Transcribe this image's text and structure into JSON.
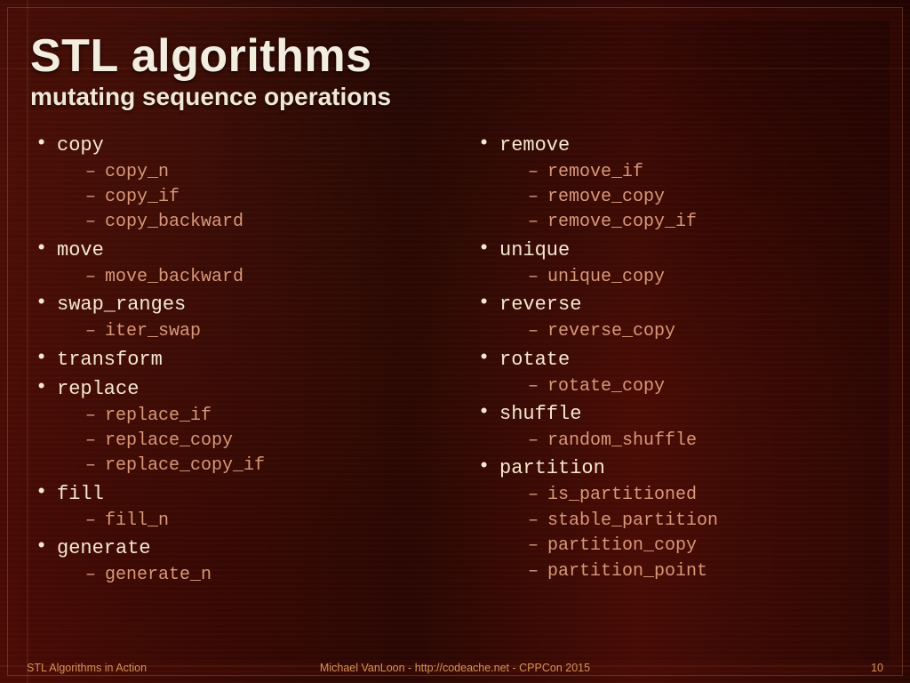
{
  "title": "STL algorithms",
  "subtitle": "mutating sequence operations",
  "columns": [
    [
      {
        "label": "copy",
        "children": [
          "copy_n",
          "copy_if",
          "copy_backward"
        ]
      },
      {
        "label": "move",
        "children": [
          "move_backward"
        ]
      },
      {
        "label": "swap_ranges",
        "children": [
          "iter_swap"
        ]
      },
      {
        "label": "transform",
        "children": []
      },
      {
        "label": "replace",
        "children": [
          "replace_if",
          "replace_copy",
          "replace_copy_if"
        ]
      },
      {
        "label": "fill",
        "children": [
          "fill_n"
        ]
      },
      {
        "label": "generate",
        "children": [
          "generate_n"
        ]
      }
    ],
    [
      {
        "label": "remove",
        "children": [
          "remove_if",
          "remove_copy",
          "remove_copy_if"
        ]
      },
      {
        "label": "unique",
        "children": [
          "unique_copy"
        ]
      },
      {
        "label": "reverse",
        "children": [
          "reverse_copy"
        ]
      },
      {
        "label": "rotate",
        "children": [
          "rotate_copy"
        ]
      },
      {
        "label": "shuffle",
        "children": [
          "random_shuffle"
        ]
      },
      {
        "label": "partition",
        "children": [
          "is_partitioned",
          "stable_partition",
          "partition_copy",
          "partition_point"
        ]
      }
    ]
  ],
  "footer": {
    "left": "STL Algorithms in Action",
    "center": "Michael VanLoon - http://codeache.net - CPPCon 2015",
    "page": "10"
  }
}
